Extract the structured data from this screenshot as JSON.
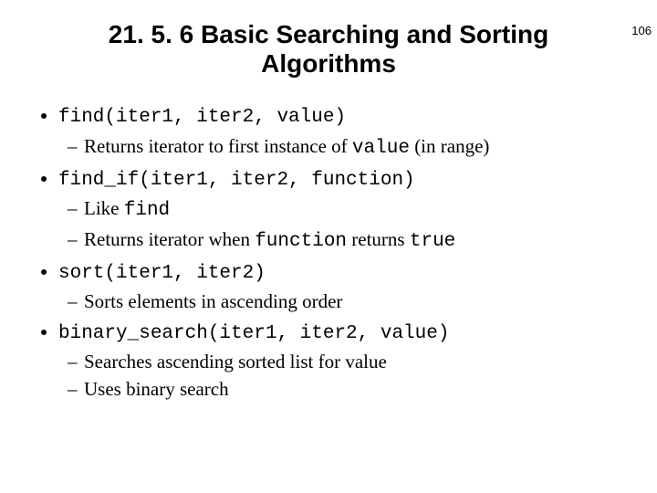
{
  "page_number": "106",
  "title": "21. 5. 6 Basic Searching and Sorting Algorithms",
  "items": [
    {
      "headline_parts": [
        {
          "t": "find(iter1, iter2, value)",
          "mono": true
        }
      ],
      "subs": [
        [
          {
            "t": "Returns iterator to first instance of "
          },
          {
            "t": "value",
            "mono": true
          },
          {
            "t": " (in range)"
          }
        ]
      ]
    },
    {
      "headline_parts": [
        {
          "t": "find_if(iter1, iter2, function)",
          "mono": true
        }
      ],
      "subs": [
        [
          {
            "t": "Like "
          },
          {
            "t": "find",
            "mono": true
          }
        ],
        [
          {
            "t": "Returns iterator when "
          },
          {
            "t": "function",
            "mono": true
          },
          {
            "t": " returns "
          },
          {
            "t": "true",
            "mono": true
          }
        ]
      ]
    },
    {
      "headline_parts": [
        {
          "t": "sort(iter1, iter2)",
          "mono": true
        }
      ],
      "subs": [
        [
          {
            "t": "Sorts elements in ascending order"
          }
        ]
      ]
    },
    {
      "headline_parts": [
        {
          "t": "binary_search(iter1, iter2, value)",
          "mono": true
        }
      ],
      "subs": [
        [
          {
            "t": "Searches ascending sorted list for value"
          }
        ],
        [
          {
            "t": "Uses binary search"
          }
        ]
      ]
    }
  ]
}
